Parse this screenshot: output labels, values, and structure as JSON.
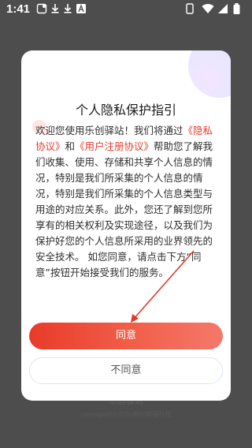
{
  "status_bar": {
    "time": "1:41",
    "icons": [
      "notification-icon",
      "download-icon",
      "download-icon",
      "letter-a-icon"
    ],
    "right_icons": [
      "phone-icon",
      "wifi-icon",
      "signal-icon",
      "battery-icon"
    ]
  },
  "background": {
    "brand": "乐创驿站",
    "copyright": "copyright@2022by柳州帮福科技"
  },
  "dialog": {
    "title": "个人隐私保护指引",
    "body": {
      "p1": "欢迎您使用乐创驿站！我们将通过",
      "link_privacy": "《隐私协议》",
      "p2": "和",
      "link_register": "《用户注册协议》",
      "p3": "帮助您了解我们收集、使用、存储和共享个人信息的情况，特别是我们所采集的个人信息的情况，特别是我们所采集的个人信息类型与用途的对应关系。此外，您还了解到您所享有的相关权利及实现途径，以及我们为保护好您的个人信息所采用的业界领先的安全技术。 如您同意，请点击下方“同意”按钮开始接受我们的服务。"
    },
    "agree_label": "同意",
    "disagree_label": "不同意"
  },
  "colors": {
    "accent": "#e83b2a",
    "link": "#e73b2c",
    "overlay": "#4d4d4d"
  }
}
